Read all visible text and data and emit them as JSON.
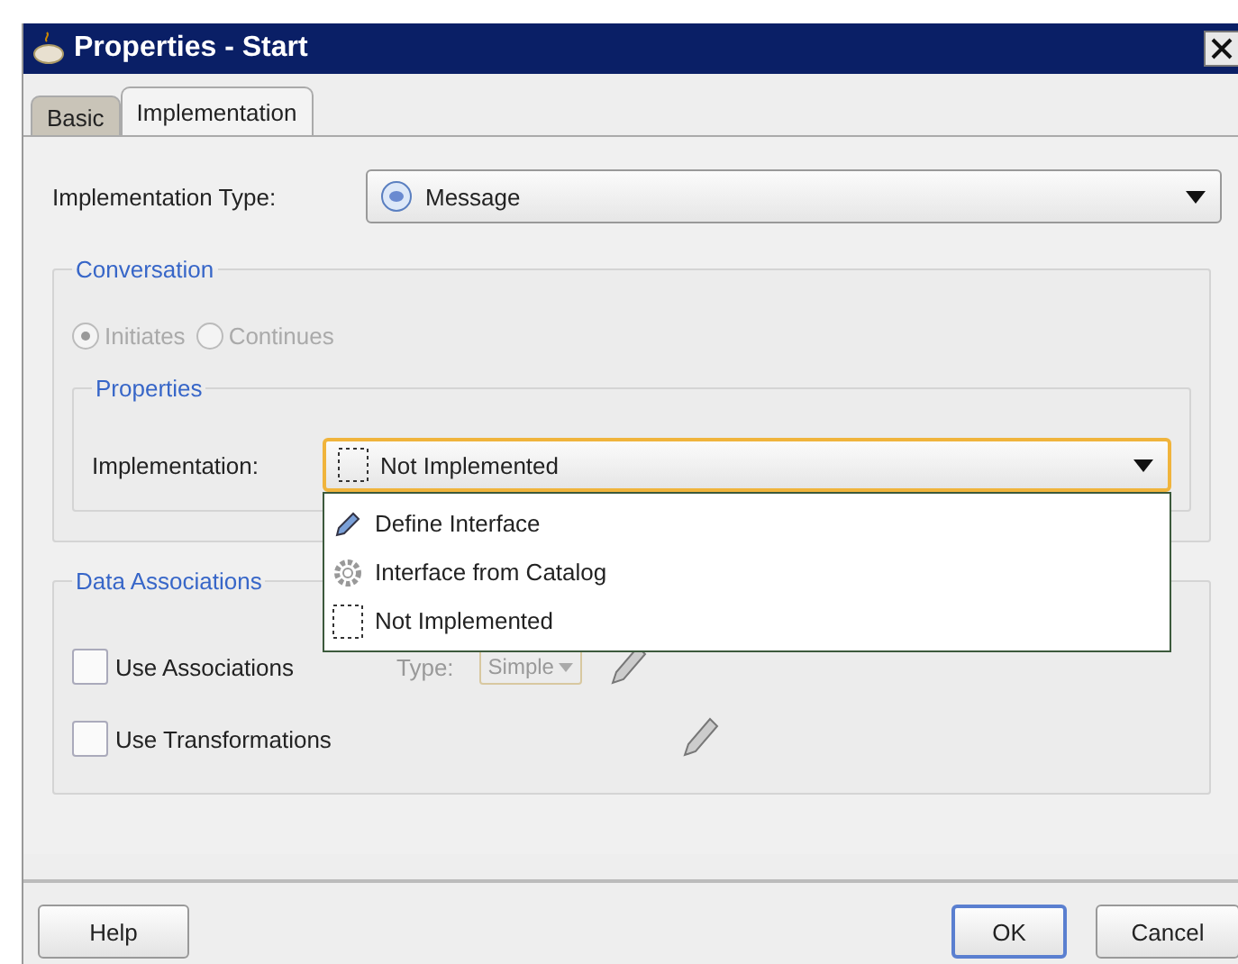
{
  "window": {
    "title": "Properties - Start"
  },
  "tabs": [
    {
      "label": "Basic",
      "selected": false
    },
    {
      "label": "Implementation",
      "selected": true
    }
  ],
  "implementation_type": {
    "label": "Implementation Type:",
    "value": "Message"
  },
  "conversation": {
    "title": "Conversation",
    "options": [
      {
        "label": "Initiates",
        "selected": true,
        "disabled": true
      },
      {
        "label": "Continues",
        "selected": false,
        "disabled": true
      }
    ],
    "properties": {
      "title": "Properties",
      "implementation": {
        "label": "Implementation:",
        "value": "Not Implemented",
        "expanded": true,
        "options": [
          {
            "kind": "pencil",
            "label": "Define Interface"
          },
          {
            "kind": "gear",
            "label": "Interface from Catalog"
          },
          {
            "kind": "dashed",
            "label": "Not Implemented"
          }
        ]
      }
    }
  },
  "data_associations": {
    "title": "Data Associations",
    "rows": [
      {
        "label": "Use Associations",
        "checked": false,
        "type_label": "Type:",
        "type_value": "Simple",
        "type_disabled": true
      },
      {
        "label": "Use Transformations",
        "checked": false
      }
    ]
  },
  "buttons": [
    {
      "label": "Help",
      "default": false
    },
    {
      "label": "OK",
      "default": true
    },
    {
      "label": "Cancel",
      "default": false
    }
  ]
}
